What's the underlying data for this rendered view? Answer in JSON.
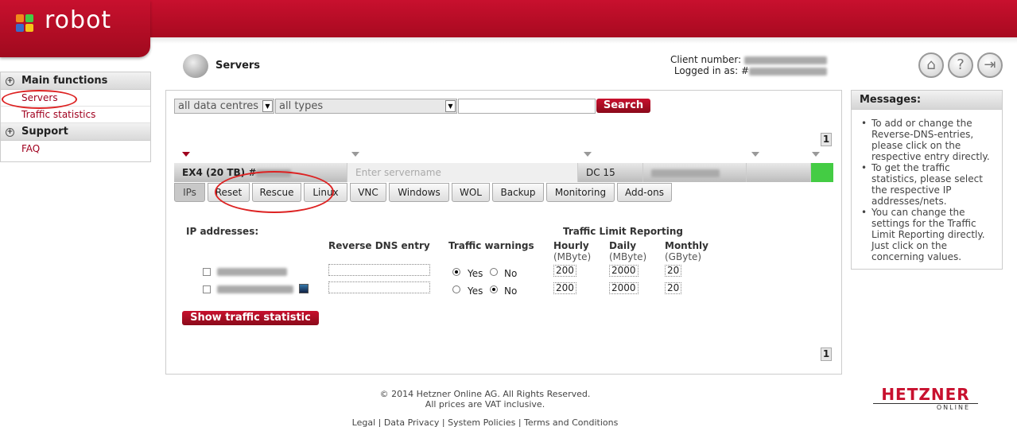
{
  "brand": {
    "logo_text": "robot",
    "colors": {
      "primary": "#c8102e",
      "green": "#44cc44",
      "orange": "#f08a1c",
      "yellow": "#f5c518",
      "blue": "#3a6bc8"
    }
  },
  "header": {
    "client_number_label": "Client number:",
    "logged_in_label": "Logged in as: #"
  },
  "page": {
    "title": "Servers",
    "icon": "server-icon"
  },
  "top_icons": [
    "home-icon",
    "help-icon",
    "logout-icon"
  ],
  "sidebar": {
    "sections": [
      {
        "title": "Main functions",
        "items": [
          "Servers",
          "Traffic statistics"
        ]
      },
      {
        "title": "Support",
        "items": [
          "FAQ"
        ]
      }
    ]
  },
  "filters": {
    "datacentre": "all data centres",
    "type": "all types",
    "search_value": "",
    "search_button": "Search"
  },
  "pagination": {
    "current_page": "1"
  },
  "server": {
    "name": "EX4 (20 TB) #",
    "servername_placeholder": "Enter servername",
    "datacentre": "DC 15"
  },
  "tabs": [
    "IPs",
    "Reset",
    "Rescue",
    "Linux",
    "VNC",
    "Windows",
    "WOL",
    "Backup",
    "Monitoring",
    "Add-ons"
  ],
  "ips_panel": {
    "ip_addresses_label": "IP addresses:",
    "reverse_dns_label": "Reverse DNS entry",
    "traffic_warnings_label": "Traffic warnings",
    "traffic_limit_label": "Traffic Limit Reporting",
    "hourly_label": "Hourly",
    "hourly_unit": "(MByte)",
    "daily_label": "Daily",
    "daily_unit": "(MByte)",
    "monthly_label": "Monthly",
    "monthly_unit": "(GByte)",
    "yes_label": "Yes",
    "no_label": "No",
    "rows": [
      {
        "warnings": "Yes",
        "hourly": "200",
        "daily": "2000",
        "monthly": "20"
      },
      {
        "warnings": "No",
        "hourly": "200",
        "daily": "2000",
        "monthly": "20"
      }
    ],
    "show_traffic_button": "Show traffic statistic"
  },
  "messages": {
    "title": "Messages:",
    "items": [
      "To add or change the Reverse-DNS-entries, please click on the respective entry directly.",
      "To get the traffic statistics, please select the respective IP addresses/nets.",
      "You can change the settings for the Traffic Limit Reporting directly. Just click on the concerning values."
    ]
  },
  "footer": {
    "copyright": "© 2014 Hetzner Online AG. All Rights Reserved.",
    "vat": "All prices are VAT inclusive.",
    "links": [
      "Legal",
      "Data Privacy",
      "System Policies",
      "Terms and Conditions"
    ]
  },
  "footer_brand": {
    "name": "HETZNER",
    "sub": "ONLINE"
  }
}
